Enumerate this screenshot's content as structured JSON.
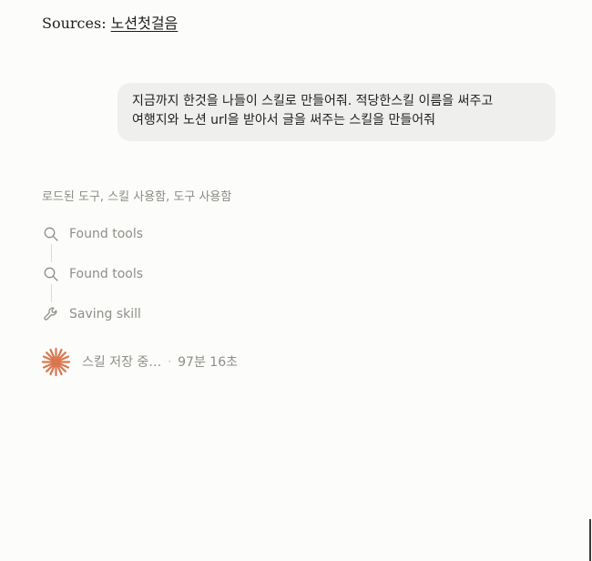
{
  "sources": {
    "prefix": "Sources:",
    "link": "노션첫걸음"
  },
  "user_message": {
    "line1": "지금까지 한것을 나들이 스킬로 만들어줘. 적당한스킬 이름을 써주고",
    "line2": "여행지와 노션 url을 받아서 글을 써주는 스킬을 만들어줘"
  },
  "tools_summary": "로드된 도구, 스킬 사용함, 도구 사용함",
  "steps": [
    {
      "icon": "search-icon",
      "label": "Found tools"
    },
    {
      "icon": "search-icon",
      "label": "Found tools"
    },
    {
      "icon": "wrench-icon",
      "label": "Saving skill"
    }
  ],
  "status": {
    "text": "스킬 저장 중…",
    "separator": "·",
    "elapsed": "97분 16초"
  },
  "colors": {
    "accent": "#d9774f",
    "muted_text": "#8e8e89",
    "bubble_bg": "#efefed",
    "page_bg": "#fcfcfa"
  }
}
